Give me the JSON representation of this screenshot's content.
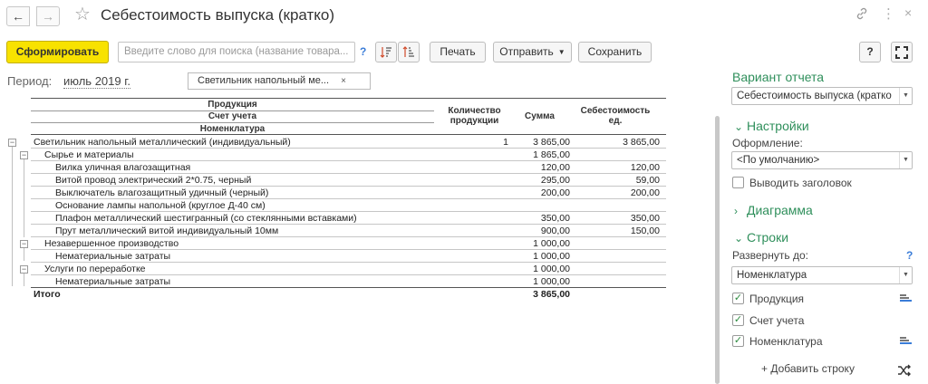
{
  "header": {
    "title": "Себестоимость выпуска (кратко)",
    "back_icon": "arrow-left-icon",
    "forward_icon": "arrow-right-icon",
    "favorite_icon": "star-icon",
    "link_icon": "link-icon",
    "more_icon": "more-vertical-icon",
    "close_icon": "close-icon"
  },
  "toolbar": {
    "generate_label": "Сформировать",
    "search_placeholder": "Введите слово для поиска (название товара...",
    "search_help": "?",
    "print_label": "Печать",
    "send_label": "Отправить",
    "save_label": "Сохранить",
    "help_label": "?",
    "accent": "#f8e200"
  },
  "period": {
    "label": "Период:",
    "value": "июль 2019 г.",
    "filter_text": "Светильник напольный ме...",
    "filter_close": "×"
  },
  "table": {
    "headers": {
      "product": "Продукция",
      "account": "Счет учета",
      "nomenclature": "Номенклатура",
      "quantity_1": "Количество",
      "quantity_2": "продукции",
      "sum": "Сумма",
      "cost_1": "Себестоимость",
      "cost_2": "ед."
    },
    "rows": [
      {
        "name": "Светильник напольный металлический (индивидуальный)",
        "qty": "1",
        "sum": "3 865,00",
        "cost": "3 865,00"
      },
      {
        "name": "Сырье и материалы",
        "qty": "",
        "sum": "1 865,00",
        "cost": ""
      },
      {
        "name": "Вилка уличная влагозащитная",
        "qty": "",
        "sum": "120,00",
        "cost": "120,00"
      },
      {
        "name": "Витой провод электрический 2*0.75, черный",
        "qty": "",
        "sum": "295,00",
        "cost": "59,00"
      },
      {
        "name": "Выключатель влагозащитный удичный (черный)",
        "qty": "",
        "sum": "200,00",
        "cost": "200,00"
      },
      {
        "name": "Основание лампы напольной (круглое Д-40 см)",
        "qty": "",
        "sum": "",
        "cost": ""
      },
      {
        "name": "Плафон металлический шестигранный (со стеклянными вставками)",
        "qty": "",
        "sum": "350,00",
        "cost": "350,00"
      },
      {
        "name": "Прут металлический витой индивидуальный 10мм",
        "qty": "",
        "sum": "900,00",
        "cost": "150,00"
      },
      {
        "name": "Незавершенное производство",
        "qty": "",
        "sum": "1 000,00",
        "cost": ""
      },
      {
        "name": "Нематериальные затраты",
        "qty": "",
        "sum": "1 000,00",
        "cost": ""
      },
      {
        "name": "Услуги по переработке",
        "qty": "",
        "sum": "1 000,00",
        "cost": ""
      },
      {
        "name": "Нематериальные затраты",
        "qty": "",
        "sum": "1 000,00",
        "cost": ""
      }
    ],
    "total": {
      "name": "Итого",
      "sum": "3 865,00"
    }
  },
  "panel": {
    "variant_title": "Вариант отчета",
    "variant_value": "Себестоимость выпуска (кратко",
    "settings_title": "Настройки",
    "design_label": "Оформление:",
    "design_value": "<По умолчанию>",
    "show_header_label": "Выводить заголовок",
    "chart_title": "Диаграмма",
    "rows_title": "Строки",
    "expand_label": "Развернуть до:",
    "expand_help": "?",
    "expand_value": "Номенклатура",
    "row_items": [
      {
        "label": "Продукция",
        "checked": "✓"
      },
      {
        "label": "Счет учета",
        "checked": "✓"
      },
      {
        "label": "Номенклатура",
        "checked": "✓"
      }
    ],
    "add_row_label": "+ Добавить строку",
    "shuffle_icon": "shuffle-icon",
    "title_color": "#2f8f5b"
  }
}
